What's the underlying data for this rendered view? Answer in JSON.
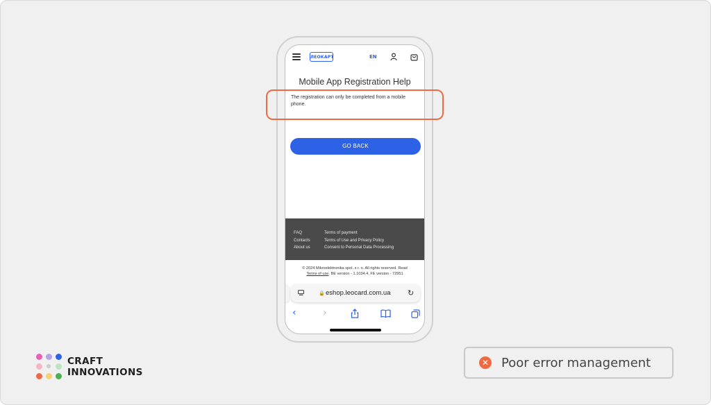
{
  "header": {
    "logo_text": "ЛЕОКАРТ",
    "language": "EN"
  },
  "page": {
    "title": "Mobile App Registration Help",
    "message": "The registration can only be completed from a mobile phone.",
    "go_back_label": "GO BACK"
  },
  "footer": {
    "col1": [
      "FAQ",
      "Contacts",
      "About us"
    ],
    "col2": [
      "Terms of payment",
      "Terms of Use and Privacy Policy",
      "Consent to Personal Data Processing"
    ],
    "copyright_line1": "© 2024 Mikroelektronika spol. s r. o. All rights reserved. Read",
    "terms_link": "Terms of use",
    "version_text": ". BE version - 1.1034.4, FE version - 72951"
  },
  "browser": {
    "url": "eshop.leocard.com.ua",
    "lock_icon": "lock-icon",
    "reload_icon": "reload-icon"
  },
  "annotation": {
    "highlight_color": "#ee6a43",
    "badge_text": "Poor error management"
  },
  "brand": {
    "line1": "CRAFT",
    "line2": "INNOVATIONS",
    "dot_colors": [
      "#e85fb8",
      "#b6a3e8",
      "#2d62e6",
      "#f4b6c3",
      "#cccccc",
      "#bfe3c0",
      "#ee6a43",
      "#f5cf7a",
      "#4caf50"
    ]
  },
  "colors": {
    "accent": "#2d62e6",
    "footer_bg": "#4a4a4a"
  }
}
